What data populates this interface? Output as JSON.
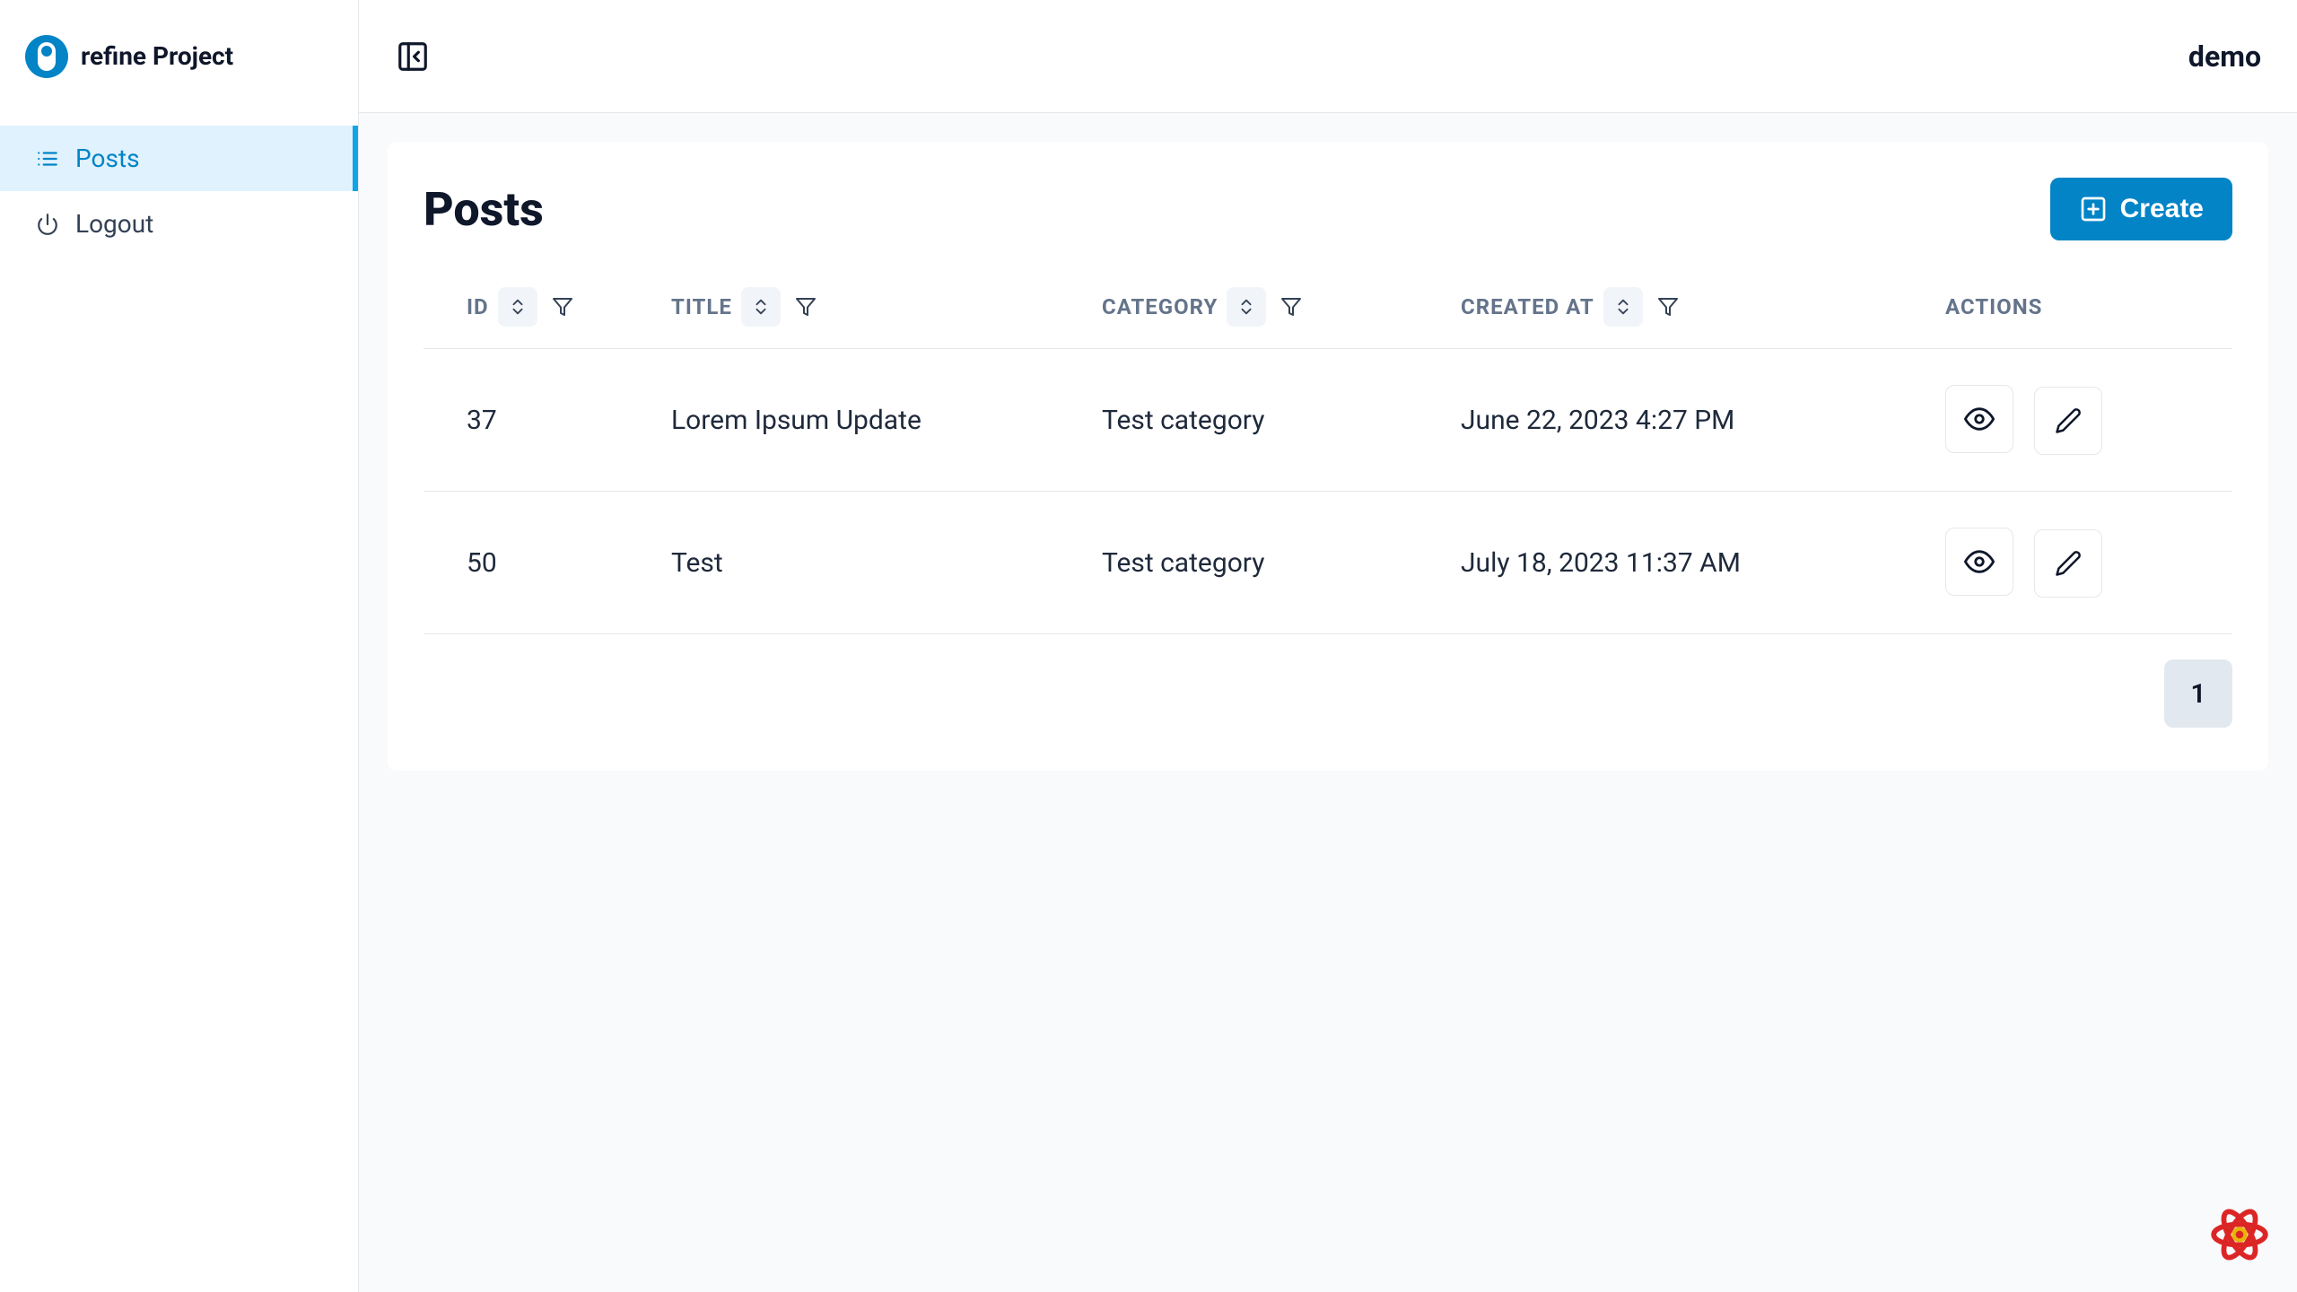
{
  "brand": {
    "title": "refine Project"
  },
  "sidebar": {
    "items": [
      {
        "label": "Posts",
        "icon": "list-icon",
        "active": true
      },
      {
        "label": "Logout",
        "icon": "power-icon",
        "active": false
      }
    ]
  },
  "topbar": {
    "user": "demo"
  },
  "page": {
    "title": "Posts",
    "create_label": "Create"
  },
  "table": {
    "columns": [
      {
        "key": "id",
        "label": "ID",
        "sortable": true,
        "filterable": true
      },
      {
        "key": "title",
        "label": "TITLE",
        "sortable": true,
        "filterable": true
      },
      {
        "key": "category",
        "label": "CATEGORY",
        "sortable": true,
        "filterable": true
      },
      {
        "key": "created_at",
        "label": "CREATED AT",
        "sortable": true,
        "filterable": true
      },
      {
        "key": "actions",
        "label": "ACTIONS",
        "sortable": false,
        "filterable": false
      }
    ],
    "rows": [
      {
        "id": "37",
        "title": "Lorem Ipsum Update",
        "category": "Test category",
        "created_at": "June 22, 2023 4:27 PM"
      },
      {
        "id": "50",
        "title": "Test",
        "category": "Test category",
        "created_at": "July 18, 2023 11:37 AM"
      }
    ]
  },
  "pagination": {
    "pages": [
      "1"
    ],
    "current": "1"
  },
  "colors": {
    "accent": "#0284c7",
    "sidebar_active_bg": "#e0f2fe"
  }
}
